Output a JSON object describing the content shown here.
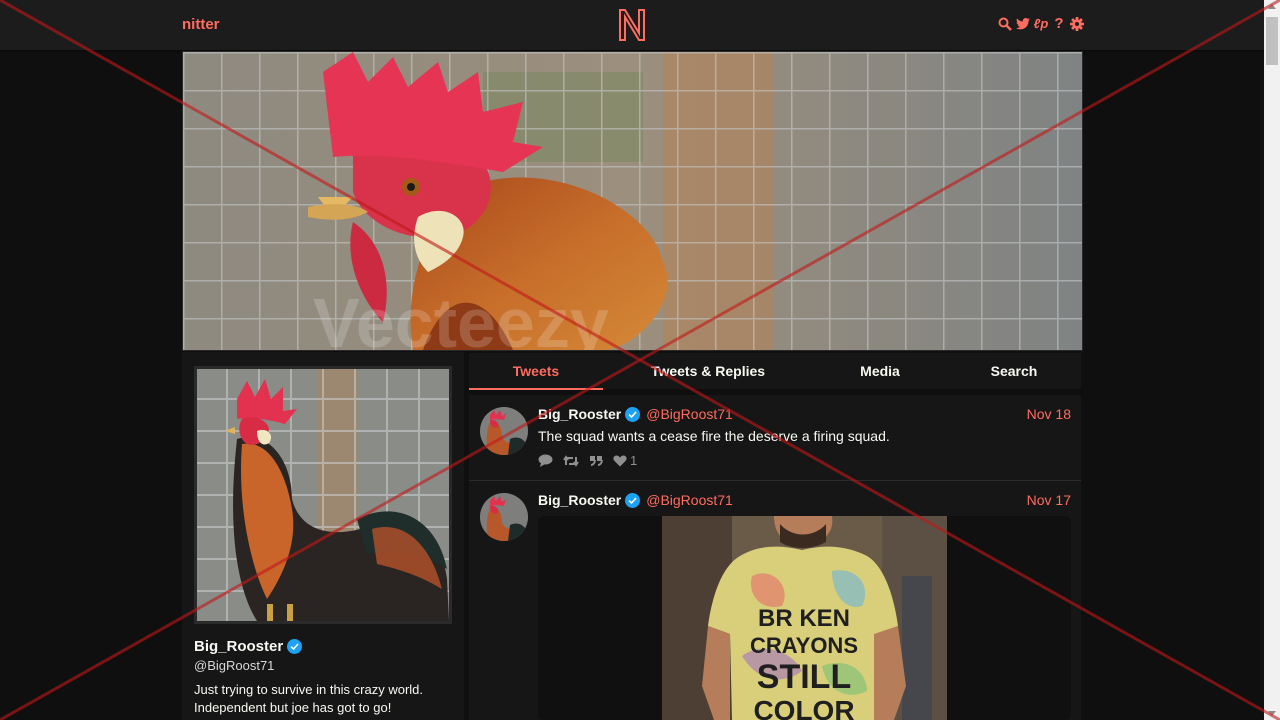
{
  "nav": {
    "brand": "nitter",
    "logo_letter": "N",
    "icons": [
      "search-icon",
      "twitter-bird-icon",
      "instance-icon",
      "help-icon",
      "gear-icon"
    ],
    "instance_label": "ℓp",
    "help_label": "?"
  },
  "colors": {
    "accent": "#ff6c60",
    "background": "#0f0f0f",
    "panel": "#161616",
    "verified": "#1da1f2"
  },
  "profile": {
    "fullname": "Big_Rooster",
    "username": "@BigRoost71",
    "bio": "Just trying to survive in this crazy world. Independent but joe has got to go!"
  },
  "tabs": [
    {
      "label": "Tweets",
      "active": true
    },
    {
      "label": "Tweets & Replies",
      "active": false
    },
    {
      "label": "Media",
      "active": false
    },
    {
      "label": "Search",
      "active": false
    }
  ],
  "tweets": [
    {
      "fullname": "Big_Rooster",
      "username": "@BigRoost71",
      "date": "Nov 18",
      "text": "The squad wants a cease fire the deserve a firing squad.",
      "likes": "1"
    },
    {
      "fullname": "Big_Rooster",
      "username": "@BigRoost71",
      "date": "Nov 17",
      "image_text": [
        "BR KEN",
        "CRAYONS",
        "STILL",
        "COLOR"
      ]
    }
  ],
  "watermark": "Vecteezy"
}
